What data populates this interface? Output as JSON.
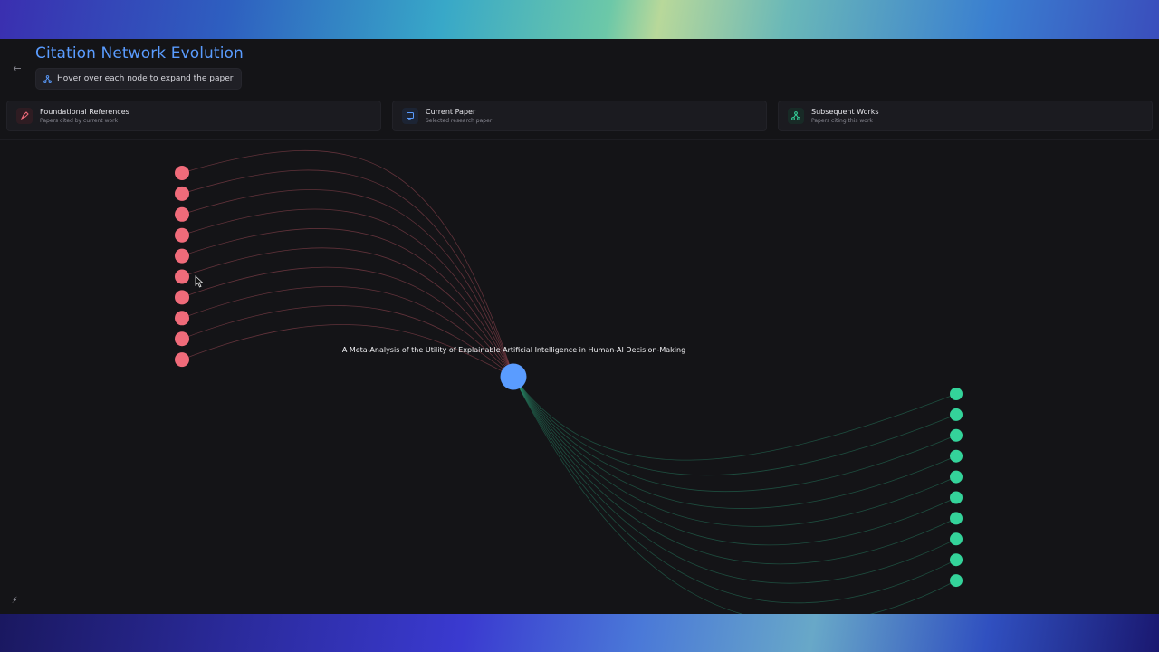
{
  "header": {
    "title": "Citation Network Evolution",
    "hint": "Hover over each node to expand the paper"
  },
  "panels": [
    {
      "title": "Foundational References",
      "subtitle": "Papers cited by current work",
      "icon": "pen-nib-icon",
      "color": "#f06b7a"
    },
    {
      "title": "Current Paper",
      "subtitle": "Selected research paper",
      "icon": "document-icon",
      "color": "#5a9cff"
    },
    {
      "title": "Subsequent Works",
      "subtitle": "Papers citing this work",
      "icon": "network-icon",
      "color": "#34d39a"
    }
  ],
  "graph": {
    "center_title": "A Meta-Analysis of the Utility of Explainable Artificial Intelligence in Human-AI Decision-Making",
    "center_color": "#5a9cff",
    "reference_color": "#f06b7a",
    "citation_color": "#34d39a",
    "reference_count": 10,
    "citation_count": 10
  }
}
